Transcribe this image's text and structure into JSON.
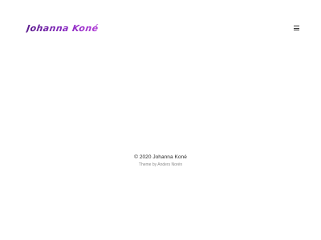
{
  "header": {
    "site_title": "Johanna Koné",
    "menu_icon": "hamburger-menu-icon"
  },
  "footer": {
    "copyright": "© 2020 Johanna Koné",
    "theme_prefix": "Theme by ",
    "theme_author": "Anders Norén"
  },
  "colors": {
    "logo_gradient_start": "#5a1a8c",
    "logo_gradient_end": "#b03ad6",
    "background": "#ffffff"
  }
}
